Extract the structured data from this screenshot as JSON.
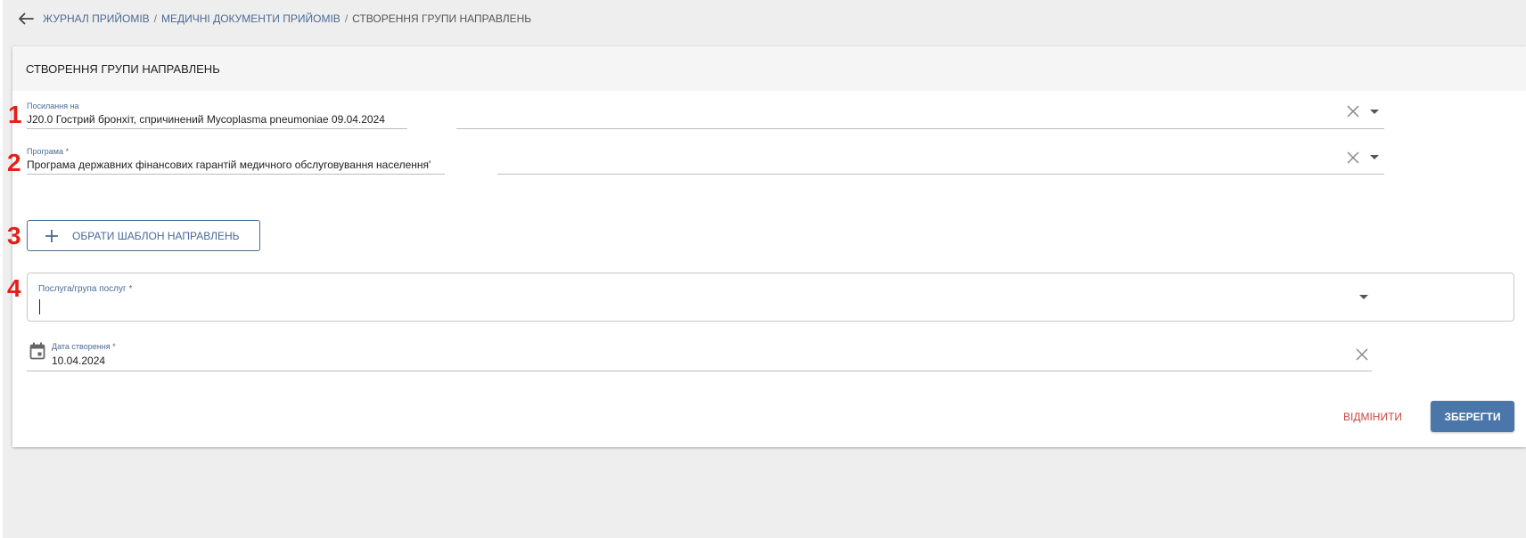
{
  "breadcrumb": {
    "items": [
      "ЖУРНАЛ ПРИЙОМІВ",
      "МЕДИЧНІ ДОКУМЕНТИ ПРИЙОМІВ"
    ],
    "separator": "/",
    "current": "СТВОРЕННЯ ГРУПИ НАПРАВЛЕНЬ"
  },
  "card": {
    "title": "СТВОРЕННЯ ГРУПИ НАПРАВЛЕНЬ"
  },
  "fields": {
    "reference": {
      "label": "Посилання на",
      "value": "J20.0 Гострий бронхіт, спричинений Mycoplasma pneumoniae 09.04.2024"
    },
    "program": {
      "label": "Програма *",
      "value": "Програма державних фінансових гарантій медичного обслуговування населення'"
    },
    "service": {
      "label": "Послуга/група послуг *",
      "value": ""
    },
    "created_date": {
      "label": "Дата створення *",
      "value": "10.04.2024"
    }
  },
  "template_button": {
    "label": "ОБРАТИ ШАБЛОН НАПРАВЛЕНЬ"
  },
  "markers": [
    "1",
    "2",
    "3",
    "4"
  ],
  "actions": {
    "cancel": "ВІДМІНИТИ",
    "save": "ЗБЕРЕГТИ"
  },
  "colors": {
    "accent": "#4a6a95",
    "primary_button": "#4a76aa",
    "cancel_text": "#c9483f",
    "marker": "#e3201a",
    "page_background": "#eeeeee"
  },
  "icons": [
    "back-arrow-icon",
    "clear-icon",
    "chevron-down-icon",
    "plus-icon",
    "calendar-icon"
  ]
}
